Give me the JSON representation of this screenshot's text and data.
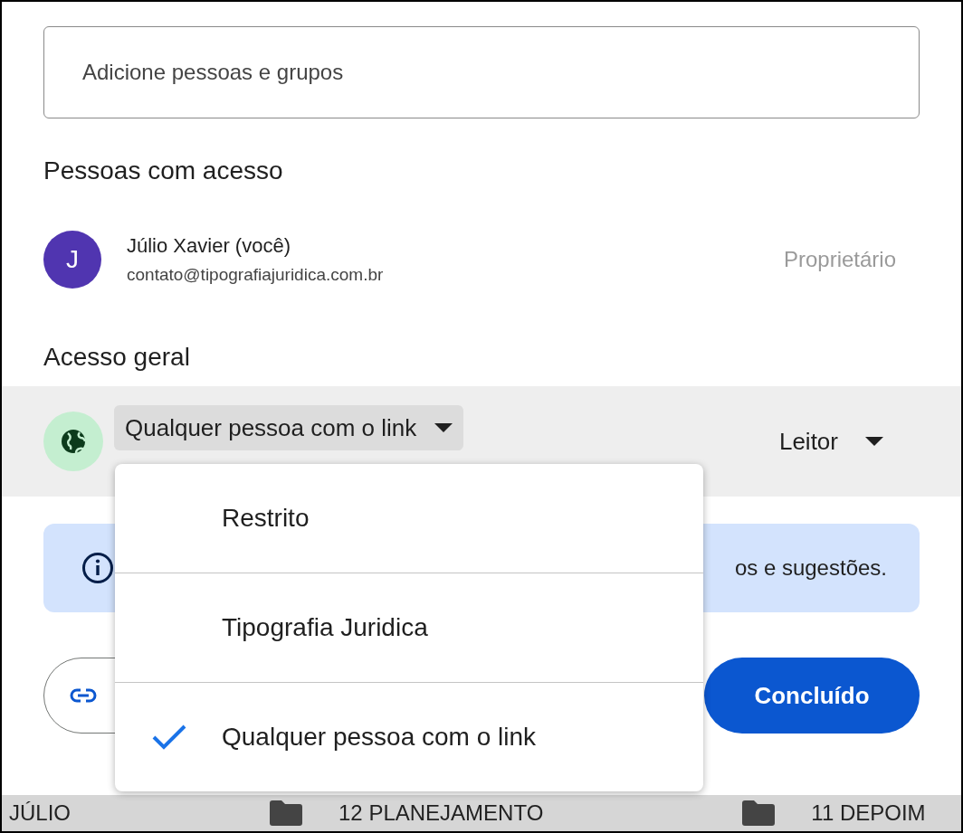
{
  "search": {
    "placeholder": "Adicione pessoas e grupos"
  },
  "people_section": {
    "title": "Pessoas com acesso"
  },
  "people": [
    {
      "initial": "J",
      "name": "Júlio Xavier (você)",
      "email": "contato@tipografiajuridica.com.br",
      "role": "Proprietário"
    }
  ],
  "general_access": {
    "title": "Acesso geral",
    "scope": "Qualquer pessoa com o link",
    "role": "Leitor"
  },
  "info_banner": {
    "text": "os e sugestões."
  },
  "done_button": "Concluído",
  "scope_menu": [
    {
      "label": "Restrito",
      "selected": false
    },
    {
      "label": "Tipografia Juridica",
      "selected": false
    },
    {
      "label": "Qualquer pessoa com o link",
      "selected": true
    }
  ],
  "taskbar": [
    {
      "kind": "text",
      "label": "JÚLIO"
    },
    {
      "kind": "folder",
      "label": "12 PLANEJAMENTO"
    },
    {
      "kind": "folder",
      "label": "11 DEPOIM"
    }
  ]
}
